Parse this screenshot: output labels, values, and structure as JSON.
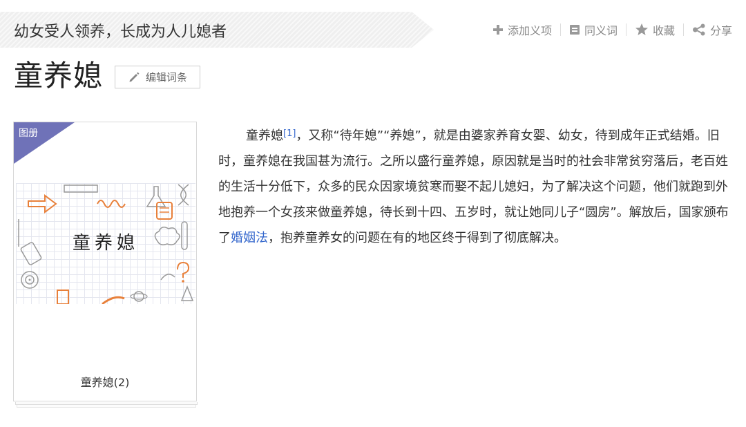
{
  "header": {
    "subtitle": "幼女受人领养，长成为人儿媳者",
    "actions": [
      {
        "label": "添加义项",
        "icon": "plus-icon"
      },
      {
        "label": "同义词",
        "icon": "synonym-icon"
      },
      {
        "label": "收藏",
        "icon": "star-icon"
      },
      {
        "label": "分享",
        "icon": "share-icon"
      }
    ]
  },
  "entry": {
    "title": "童养媳",
    "edit_label": "编辑词条"
  },
  "album": {
    "corner_label": "图册",
    "image_text": "童养媳",
    "caption": "童养媳(2)"
  },
  "content": {
    "p1_start": "童养媳",
    "ref": "[1]",
    "p1_mid": "，又称“待年媳”“养媳”，就是由婆家养育女婴、幼女，待到成年正式结婚。旧时，童养媳在我国甚为流行。之所以盛行童养媳，原因就是当时的社会非常贫穷落后，老百姓的生活十分低下，众多的民众因家境贫寒而娶不起儿媳妇，为了解决这个问题，他们就跑到外地抱养一个女孩来做童养媳，待长到十四、五岁时，就让她同儿子“圆房”。解放后，国家颁布了",
    "link": "婚姻法",
    "p1_end": "，抱养童养女的问题在有的地区终于得到了彻底解决。"
  },
  "colors": {
    "accent": "#6f72b8",
    "link": "#3366cc",
    "icon_gray": "#9a9a9a"
  }
}
